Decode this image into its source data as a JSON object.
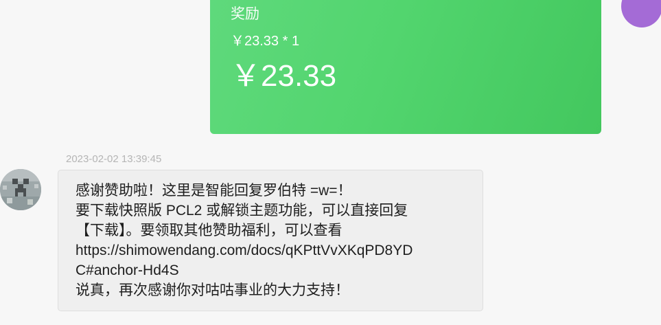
{
  "order_card": {
    "title": "奖励",
    "price_line": "￥23.33 * 1",
    "total": "￥23.33"
  },
  "message": {
    "timestamp": "2023-02-02 13:39:45",
    "lines": [
      "感谢赞助啦！这里是智能回复罗伯特 =w=！",
      "要下载快照版 PCL2 或解锁主题功能，可以直接回复",
      "【下载】。要领取其他赞助福利，可以查看",
      "https://shimowendang.com/docs/qKPttVvXKqPD8YD",
      "C#anchor-Hd4S",
      "说真，再次感谢你对咕咕事业的大力支持！"
    ]
  },
  "colors": {
    "card_green": "#52d56e",
    "bubble_bg": "#efefef",
    "self_avatar": "#a46bd6",
    "page_bg": "#f7f7f7"
  }
}
